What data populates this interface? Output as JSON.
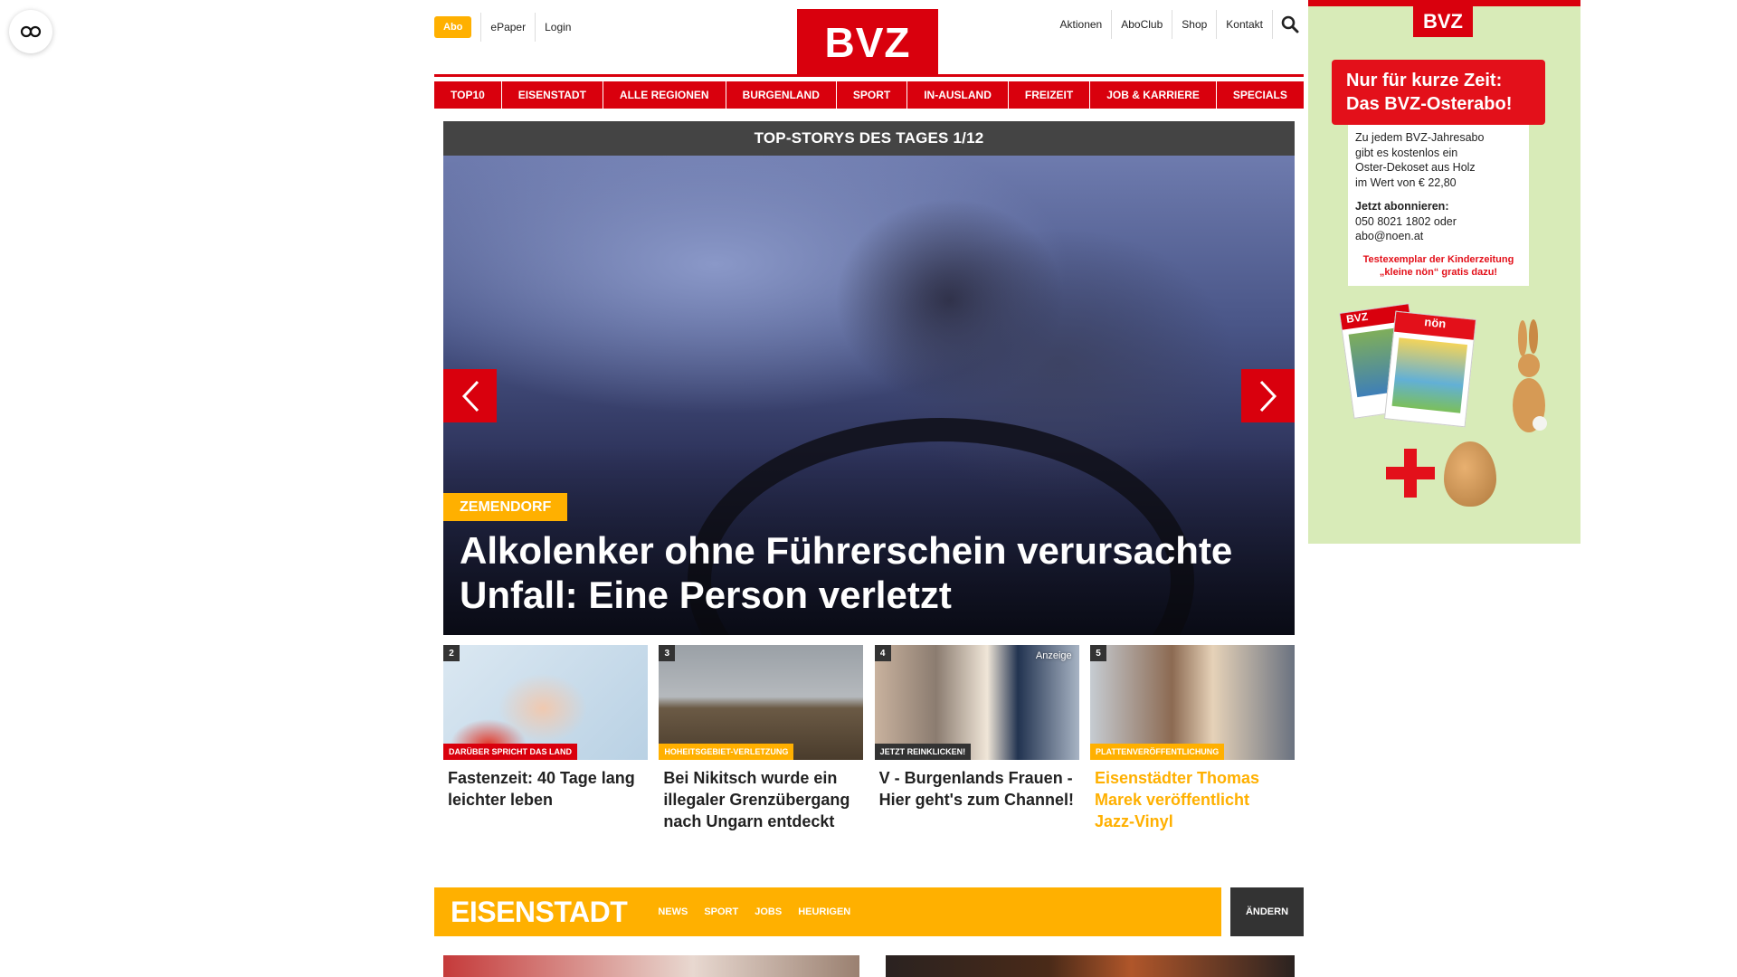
{
  "header": {
    "abo_label": "Abo",
    "epaper_label": "ePaper",
    "login_label": "Login",
    "logo_text": "BVZ",
    "right_links": [
      "Aktionen",
      "AboClub",
      "Shop",
      "Kontakt"
    ]
  },
  "nav": {
    "items": [
      "TOP10",
      "EISENSTADT",
      "ALLE REGIONEN",
      "BURGENLAND",
      "SPORT",
      "IN-AUSLAND",
      "FREIZEIT",
      "JOB & KARRIERE",
      "SPECIALS"
    ]
  },
  "top_stories": {
    "heading": "TOP-STORYS DES TAGES 1/12",
    "hero_tag": "ZEMENDORF",
    "hero_title": "Alkolenker ohne Führerschein verursachte Unfall: Eine Person verletzt",
    "teasers": [
      {
        "num": "2",
        "tag": "DARÜBER SPRICHT DAS LAND",
        "tag_color": "#d9000d",
        "title": "Fastenzeit: 40 Tage lang leichter leben",
        "ad": ""
      },
      {
        "num": "3",
        "tag": "HOHEITSGEBIET-VERLETZUNG",
        "tag_color": "#ffb000",
        "title": "Bei Nikitsch wurde ein illegaler Grenzübergang nach Ungarn entdeckt",
        "ad": ""
      },
      {
        "num": "4",
        "tag": "JETZT REINKLICKEN!",
        "tag_color": "#333333",
        "title": "V - Burgenlands Frauen - Hier geht's zum Channel!",
        "ad": "Anzeige"
      },
      {
        "num": "5",
        "tag": "PLATTENVERÖFFENTLICHUNG",
        "tag_color": "#ffb000",
        "title": "Eisenstädter Thomas Marek veröffentlicht Jazz-Vinyl",
        "ad": ""
      }
    ]
  },
  "region": {
    "title": "EISENSTADT",
    "links": [
      "NEWS",
      "SPORT",
      "JOBS",
      "HEURIGEN"
    ],
    "change_label": "ÄNDERN"
  },
  "ad": {
    "logo": "BVZ",
    "headline_1": "Nur für kurze Zeit:",
    "headline_2": "Das BVZ-Osterabo!",
    "body_1": "Zu jedem BVZ-Jahresabo",
    "body_2": "gibt es kostenlos ein",
    "body_3": "Oster-Dekoset aus Holz",
    "body_4": "im Wert von € 22,80",
    "cta": "Jetzt abonnieren:",
    "phone": "050 8021 1802 oder",
    "email": "abo@noen.at",
    "offer_1": "Testexemplar der Kinderzeitung",
    "offer_2": "„kleine nön“ gratis dazu!",
    "mag1_logo": "BVZ",
    "mag2_logo": "nön"
  },
  "colors": {
    "brand_red": "#d9000d",
    "accent_gold": "#ffb000",
    "dark": "#444444"
  }
}
